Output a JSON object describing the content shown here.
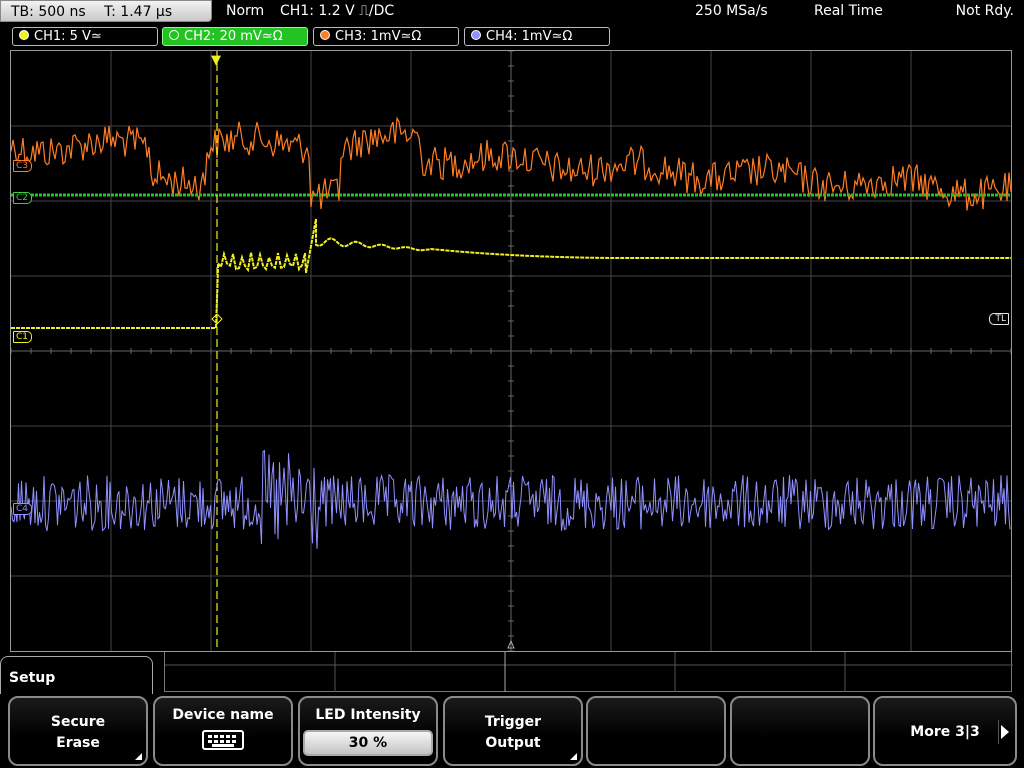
{
  "topbar": {
    "timebase": "TB: 500 ns",
    "trigger_time": "T: 1.47 µs",
    "trigger_mode": "Norm",
    "trigger_setting": "CH1: 1.2 V ⎍/DC",
    "sample_rate": "250 MSa/s",
    "acquisition_mode": "Real Time",
    "status": "Not Rdy."
  },
  "channels": [
    {
      "label": "CH1: 5 V≃",
      "color": "#f0f020"
    },
    {
      "label": "CH2: 20 mV≃Ω",
      "color": "#22c322"
    },
    {
      "label": "CH3: 1mV≃Ω",
      "color": "#ff7e25"
    },
    {
      "label": "CH4: 1mV≃Ω",
      "color": "#9090ff"
    }
  ],
  "markers": {
    "c1": "C1",
    "c2": "C2",
    "c3": "C3",
    "c4": "C4",
    "tl": "TL"
  },
  "menu": {
    "title": "Setup",
    "secure_erase": {
      "line1": "Secure",
      "line2": "Erase"
    },
    "device_name": {
      "label": "Device name",
      "icon": "keyboard-icon"
    },
    "led_intensity": {
      "label": "LED Intensity",
      "value": "30 %"
    },
    "trigger_output": {
      "line1": "Trigger",
      "line2": "Output"
    },
    "more": {
      "label": "More 3|3",
      "icon": "arrow-right-icon"
    }
  },
  "colors": {
    "ch1": "#f0f020",
    "ch2": "#22c322",
    "ch3": "#ff7e25",
    "ch4": "#9090ff",
    "grid": "#444444",
    "trigger_line": "#f0f020"
  }
}
